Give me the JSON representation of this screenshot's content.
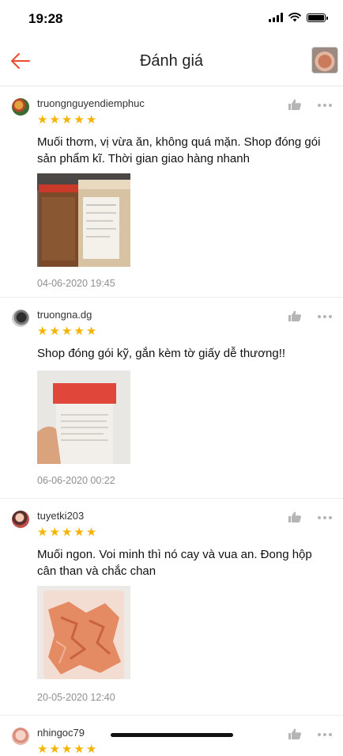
{
  "status_bar": {
    "time": "19:28"
  },
  "nav": {
    "title": "Đánh giá"
  },
  "reviews": [
    {
      "username": "truongnguyendiemphuc",
      "rating": 5,
      "comment": "Muối thơm, vị vừa ăn, không quá mặn. Shop đóng gói sản phẩm kĩ. Thời gian giao hàng nhanh",
      "date": "04-06-2020 19:45"
    },
    {
      "username": "truongna.dg",
      "rating": 5,
      "comment": "Shop đóng gói kỹ, gắn kèm tờ giấy dễ thương!!",
      "date": "06-06-2020 00:22"
    },
    {
      "username": "tuyetki203",
      "rating": 5,
      "comment": "Muối ngon. Voi minh thì nó cay và vua an. Đong hộp cân than và chắc chan",
      "date": "20-05-2020 12:40"
    },
    {
      "username": "nhingoc79",
      "rating": 5
    }
  ],
  "colors": {
    "accent": "#ee4d2d",
    "star": "#f5b301"
  },
  "icons": [
    "back-arrow-icon",
    "thumbs-up-icon",
    "more-options-icon",
    "star-icon"
  ]
}
